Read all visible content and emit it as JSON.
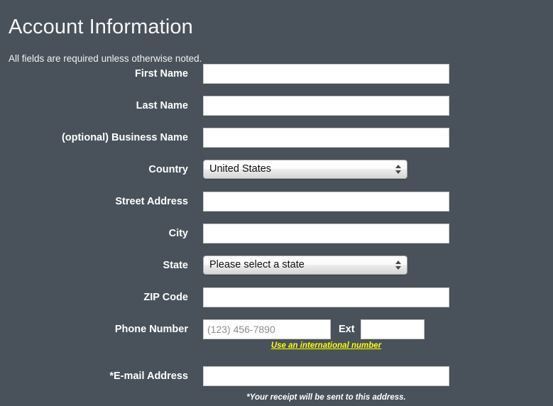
{
  "header": {
    "title": "Account Information",
    "subtitle": "All fields are required unless otherwise noted."
  },
  "form": {
    "fields": {
      "first_name": {
        "label": "First Name",
        "value": "",
        "placeholder": ""
      },
      "last_name": {
        "label": "Last Name",
        "value": "",
        "placeholder": ""
      },
      "business_name": {
        "label": "(optional) Business Name",
        "value": "",
        "placeholder": ""
      },
      "country": {
        "label": "Country",
        "selected": "United States"
      },
      "street_address": {
        "label": "Street Address",
        "value": "",
        "placeholder": ""
      },
      "city": {
        "label": "City",
        "value": "",
        "placeholder": ""
      },
      "state": {
        "label": "State",
        "selected": "Please select a state"
      },
      "zip_code": {
        "label": "ZIP Code",
        "value": "",
        "placeholder": ""
      },
      "phone_number": {
        "label": "Phone Number",
        "value": "",
        "placeholder": "(123) 456-7890",
        "ext_label": "Ext",
        "ext_value": "",
        "helper_link": "Use an international number"
      },
      "email_address": {
        "label": "*E-mail Address",
        "value": "",
        "placeholder": "",
        "note": "*Your receipt will be sent to this address."
      }
    }
  },
  "colors": {
    "background": "#49525a",
    "label_text": "#ffffff",
    "link_yellow": "#ffff00",
    "input_background": "#ffffff"
  }
}
